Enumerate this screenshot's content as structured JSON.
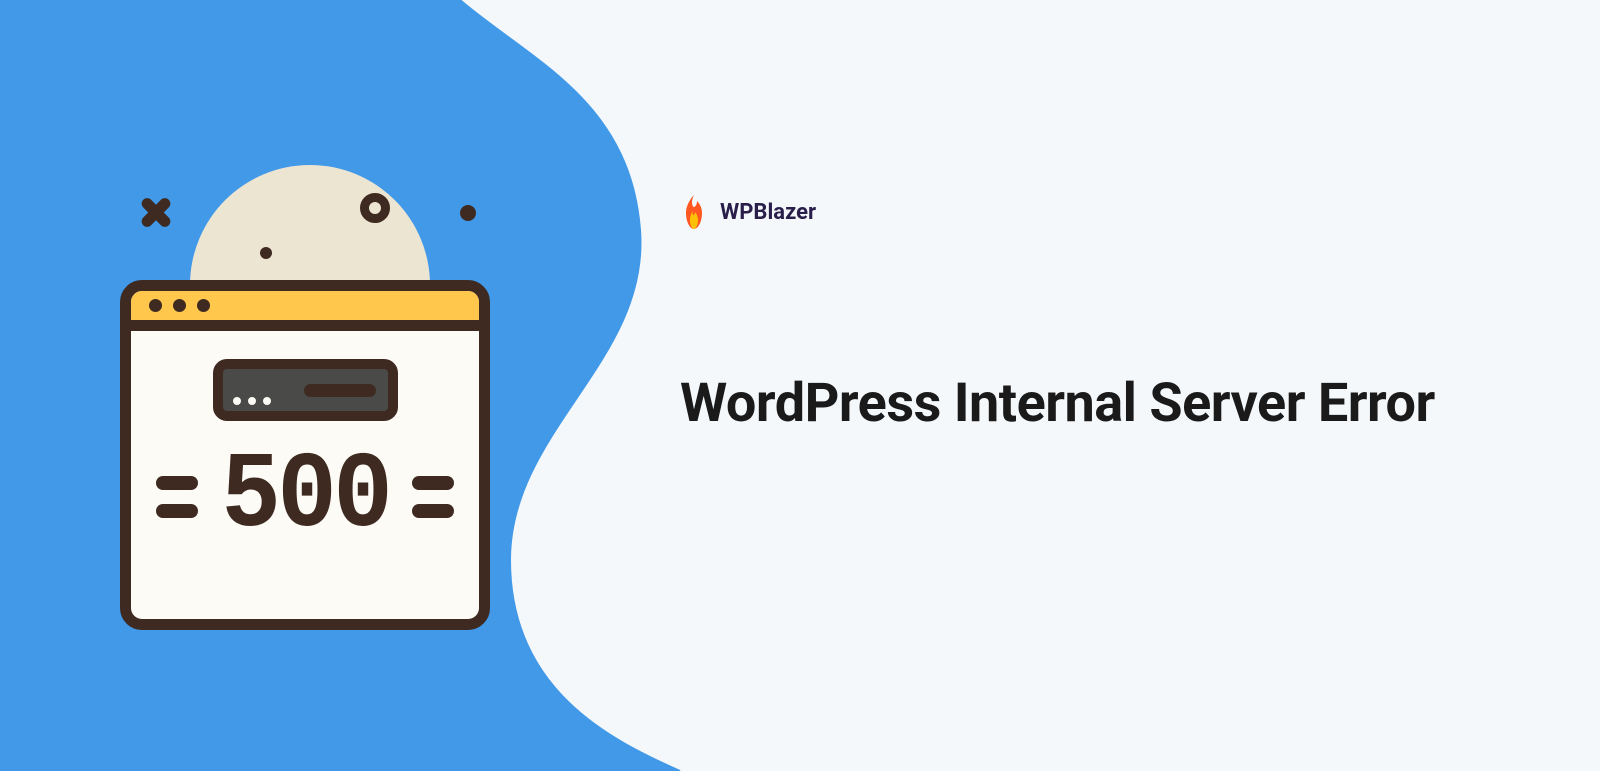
{
  "brand": {
    "name": "WPBlazer",
    "icon": "flame-icon"
  },
  "headline": "WordPress Internal Server Error",
  "illustration": {
    "error_code": "500",
    "window_type": "browser-window",
    "accent_color": "#ffc84c"
  },
  "colors": {
    "primary_blue": "#4199e8",
    "bg_light": "#f5f8fb",
    "dark_brown": "#3f2a22",
    "moon": "#ece5d2"
  }
}
